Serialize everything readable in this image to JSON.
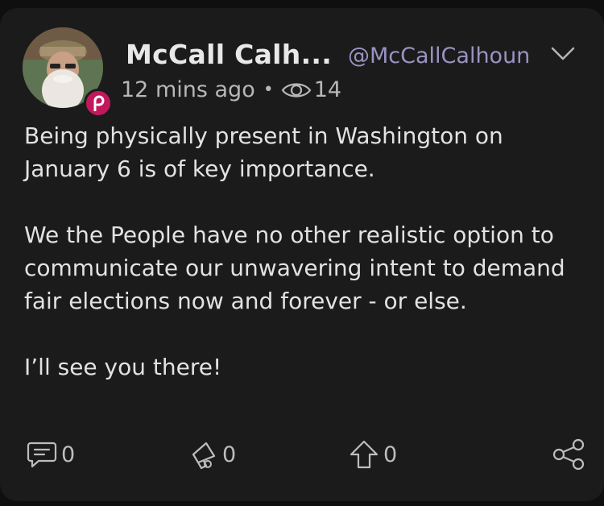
{
  "author": {
    "display_name": "McCall Calh...",
    "handle": "@McCallCalhoun",
    "avatar_icon": "user-avatar",
    "badge_icon": "parler-badge-icon",
    "badge_color": "#c2185b"
  },
  "meta": {
    "time_ago": "12 mins ago",
    "separator": "•",
    "views": "14"
  },
  "post": {
    "paragraphs": [
      "Being physically present in Washington on January 6 is of key importance.",
      "We the People have no other realistic option to communicate our unwavering intent to demand fair elections now and forever - or else.",
      "I’ll see you there!"
    ]
  },
  "actions": {
    "comments": "0",
    "echoes": "0",
    "upvotes": "0"
  },
  "colors": {
    "background": "#1b1b1b",
    "text": "#e2e2e2",
    "handle": "#9a93c2",
    "muted": "#b7b7b7"
  }
}
